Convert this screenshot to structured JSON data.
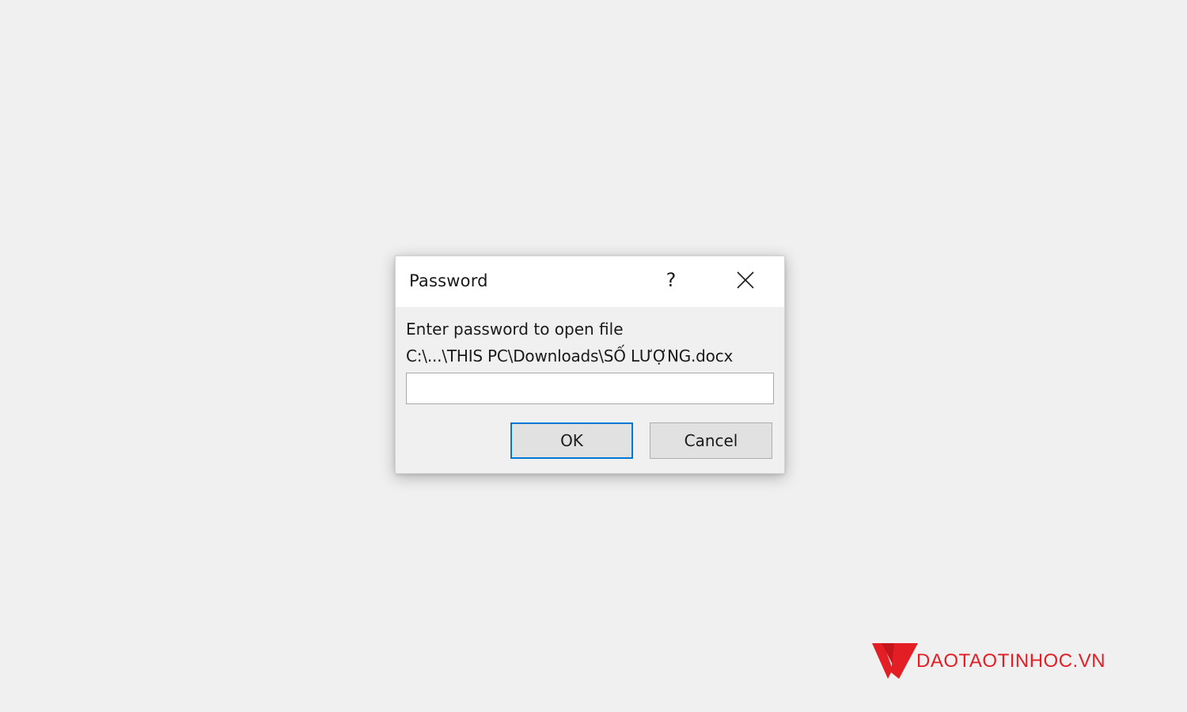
{
  "dialog": {
    "title": "Password",
    "help_label": "?",
    "prompt": "Enter password to open file",
    "file_path": "C:\\...\\THIS PC\\Downloads\\SỐ LƯỢNG.docx",
    "password_value": "",
    "ok_label": "OK",
    "cancel_label": "Cancel"
  },
  "watermark": {
    "brand_text": "DAOTAOTINHOC.VN",
    "brand_color": "#e31e24"
  },
  "colors": {
    "background": "#f0f0f0",
    "titlebar": "#ffffff",
    "focus_border": "#0078d7",
    "button_face": "#e1e1e1"
  },
  "icons": {
    "close": "close-icon",
    "help": "help-icon",
    "logo": "brand-logo-icon"
  }
}
